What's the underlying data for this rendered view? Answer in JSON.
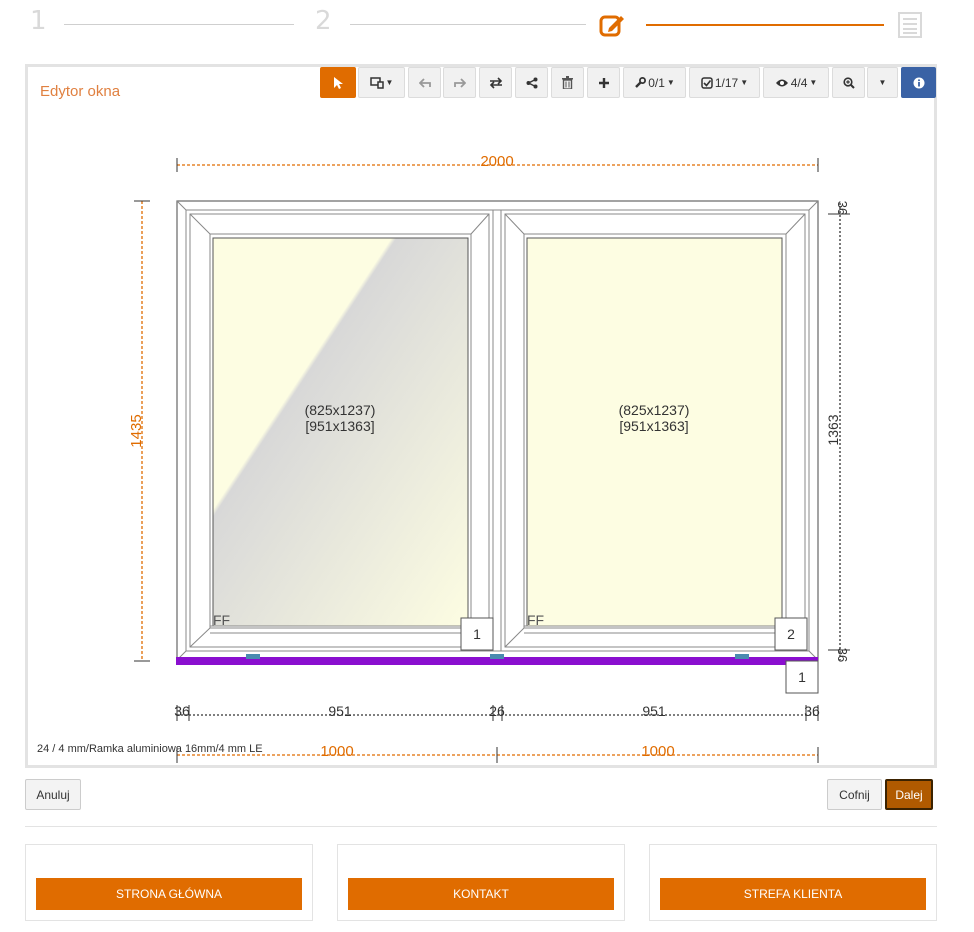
{
  "steps": {
    "step1": "1",
    "step2": "2"
  },
  "editor": {
    "title": "Edytor okna",
    "toolbar": {
      "tools_count": "0/1",
      "checks_count": "1/17",
      "views_count": "4/4"
    },
    "glass_note": "24 / 4 mm/Ramka aluminiowa 16mm/4 mm LE"
  },
  "drawing": {
    "total_width": "2000",
    "total_height": "1435",
    "right_height": "1363",
    "top_offset": "36",
    "bottom_offset": "36",
    "sash1": {
      "size": "(825x1237)",
      "frame": "[951x1363]",
      "type": "FF",
      "number": "1"
    },
    "sash2": {
      "size": "(825x1237)",
      "frame": "[951x1363]",
      "type": "FF",
      "number": "2"
    },
    "frame_number": "1",
    "bottom_dims": [
      "36",
      "951",
      "26",
      "951",
      "36"
    ],
    "half_widths": [
      "1000",
      "1000"
    ]
  },
  "actions": {
    "cancel": "Anuluj",
    "back": "Cofnij",
    "next": "Dalej"
  },
  "footer": {
    "home": "STRONA GŁÓWNA",
    "contact": "KONTAKT",
    "client_zone": "STREFA KLIENTA"
  },
  "colors": {
    "accent": "#e06c00",
    "info": "#3a62a5",
    "glass": "#fdfde2",
    "sill": "#8a0fcf"
  }
}
